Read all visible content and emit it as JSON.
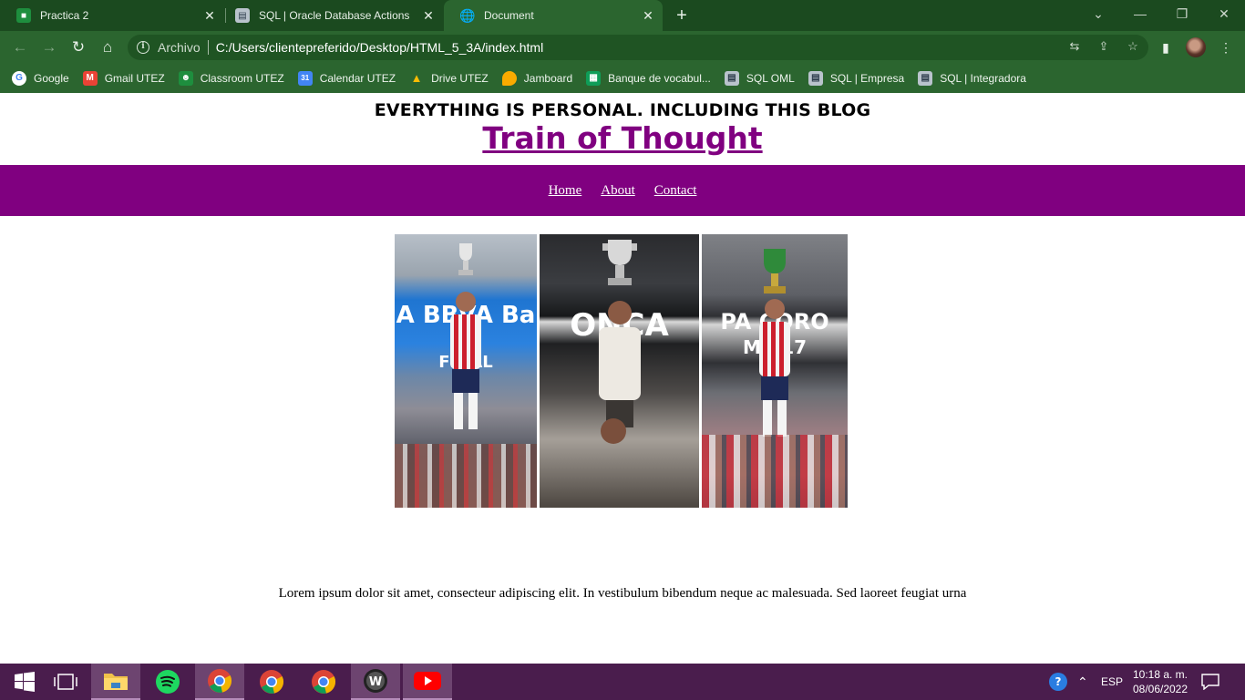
{
  "browser": {
    "tabs": [
      {
        "title": "Practica 2",
        "icon": "classroom-icon",
        "active": false
      },
      {
        "title": "SQL | Oracle Database Actions",
        "icon": "database-icon",
        "active": false
      },
      {
        "title": "Document",
        "icon": "globe-icon",
        "active": true
      }
    ],
    "address": {
      "label": "Archivo",
      "url": "C:/Users/clientepreferido/Desktop/HTML_5_3A/index.html"
    },
    "bookmarks": [
      {
        "label": "Google",
        "icon": "google-icon",
        "color": "#ffffff"
      },
      {
        "label": "Gmail UTEZ",
        "icon": "gmail-icon",
        "color": "#ea4335"
      },
      {
        "label": "Classroom UTEZ",
        "icon": "classroom-icon",
        "color": "#1e8e3e"
      },
      {
        "label": "Calendar UTEZ",
        "icon": "calendar-icon",
        "color": "#4285f4"
      },
      {
        "label": "Drive UTEZ",
        "icon": "drive-icon",
        "color": "#fbbc04"
      },
      {
        "label": "Jamboard",
        "icon": "jamboard-icon",
        "color": "#f9ab00"
      },
      {
        "label": "Banque de vocabul...",
        "icon": "sheets-icon",
        "color": "#0f9d58"
      },
      {
        "label": "SQL OML",
        "icon": "database-icon",
        "color": "#9aa0a6"
      },
      {
        "label": "SQL | Empresa",
        "icon": "database-icon",
        "color": "#9aa0a6"
      },
      {
        "label": "SQL | Integradora",
        "icon": "database-icon",
        "color": "#9aa0a6"
      }
    ]
  },
  "page": {
    "tagline": "EVERYTHING IS PERSONAL. INCLUDING THIS BLOG",
    "title": "Train of Thought",
    "nav": [
      "Home",
      "About",
      "Contact"
    ],
    "paragraph": "Lorem ipsum dolor sit amet, consecteur adipiscing elit. In vestibulum bibendum neque ac malesuada. Sed laoreet feugiat urna",
    "accent_color": "#800080",
    "image_alt_banners": [
      "A BBVA Ba",
      "FINAL",
      "ONCA",
      "PA CORO",
      "MX 17"
    ]
  },
  "taskbar": {
    "language": "ESP",
    "time": "10:18 a. m.",
    "date": "08/06/2022"
  }
}
